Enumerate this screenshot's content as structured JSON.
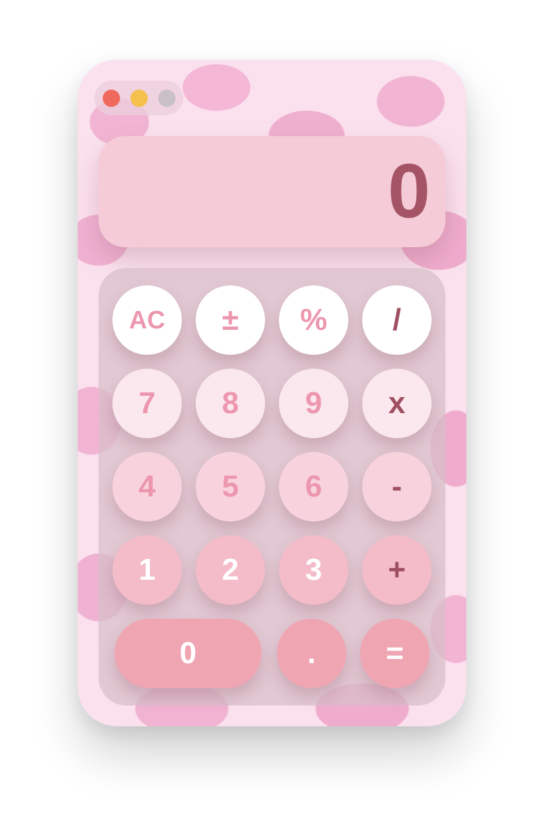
{
  "window": {
    "controls": {
      "close_color": "#ef6a5c",
      "minimize_color": "#f6c04d",
      "maximize_color": "#c9c1c6"
    }
  },
  "display": {
    "value": "0"
  },
  "keypad": {
    "rows": [
      [
        "AC",
        "±",
        "%",
        "/"
      ],
      [
        "7",
        "8",
        "9",
        "x"
      ],
      [
        "4",
        "5",
        "6",
        "-"
      ],
      [
        "1",
        "2",
        "3",
        "+"
      ],
      [
        "0",
        ".",
        "="
      ]
    ]
  },
  "colors": {
    "accent_text": "#ec97ad",
    "operator_text": "#9f4f60",
    "display_text": "#a45465",
    "display_bg": "#f4cbd6"
  }
}
